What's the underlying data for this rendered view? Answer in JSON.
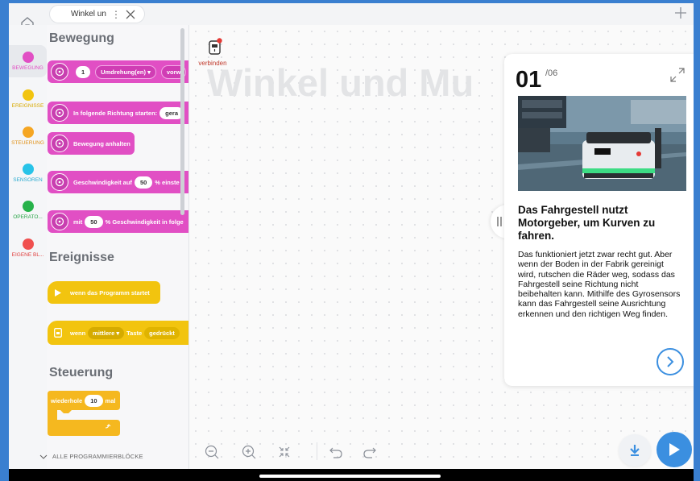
{
  "topbar": {
    "tab_title": "Winkel un...",
    "tab_more": "⋮"
  },
  "rail": {
    "categories": [
      {
        "label": "BEWEGUNG",
        "color": "#e14fc4"
      },
      {
        "label": "EREIGNISSE",
        "color": "#f2c40f"
      },
      {
        "label": "STEUERUNG",
        "color": "#f5a623"
      },
      {
        "label": "SENSOREN",
        "color": "#28c3e8"
      },
      {
        "label": "OPERATO...",
        "color": "#27b24a"
      },
      {
        "label": "EIGENE BL...",
        "color": "#f0504f"
      }
    ]
  },
  "palette": {
    "sections": {
      "motion": "Bewegung",
      "events": "Ereignisse",
      "control": "Steuerung"
    },
    "blocks": {
      "move_rotations_value": "1",
      "move_rotations_unit": "Umdrehung(en) ▾",
      "move_direction": "vorw",
      "start_direction_text": "In folgende Richtung starten:",
      "start_direction_value": "gera",
      "stop_text": "Bewegung anhalten",
      "speed_text": "Geschwindigkeit auf",
      "speed_value": "50",
      "speed_suffix": "% einste",
      "with_text": "mit",
      "with_value": "50",
      "with_suffix": "% Geschwindigkeit in folge",
      "program_start": "wenn das Programm startet",
      "button_when": "wenn",
      "button_which": "mittlere ▾",
      "button_label": "Taste",
      "button_state": "gedrückt",
      "repeat_text": "wiederhole",
      "repeat_value": "10",
      "repeat_suffix": "mal"
    },
    "all_blocks": "ALLE PROGRAMMIERBLÖCKE"
  },
  "canvas": {
    "connect_label": "verbinden",
    "title": "Winkel und Mu"
  },
  "lesson": {
    "number": "01",
    "total": "/06",
    "heading": "Das Fahrgestell nutzt Motorgeber, um Kurven zu fahren.",
    "body": "Das funktioniert jetzt zwar recht gut. Aber wenn der Boden in der Fabrik gereinigt wird, rutschen die Räder weg, sodass das Fahrgestell seine Richtung nicht beibehalten kann. Mithilfe des Gyrosensors kann das Fahrgestell seine Ausrichtung erkennen und den richtigen Weg finden."
  },
  "icons": [
    "home-icon",
    "close-icon",
    "plus-icon",
    "motor-icon",
    "play-icon",
    "hub-icon",
    "zoom-out-icon",
    "zoom-in-icon",
    "center-icon",
    "undo-icon",
    "redo-icon",
    "expand-icon",
    "next-arrow-icon",
    "download-icon"
  ],
  "colors": {
    "motion": "#e14fc4",
    "events": "#f2c40f",
    "accent": "#3b8fe0",
    "connect": "#c0392b"
  }
}
